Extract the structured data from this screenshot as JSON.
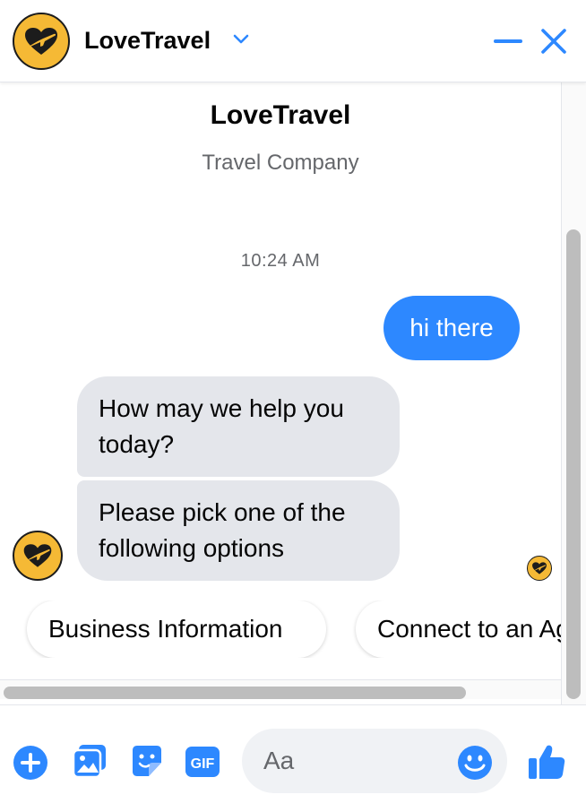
{
  "header": {
    "title": "LoveTravel",
    "avatar_icon": "heart-plane-logo-icon",
    "chevron_icon": "chevron-down-icon",
    "minimize_icon": "minimize-icon",
    "close_icon": "close-icon"
  },
  "profile": {
    "name": "LoveTravel",
    "subtitle": "Travel Company"
  },
  "conversation": {
    "timestamp": "10:24 AM",
    "messages": [
      {
        "from": "user",
        "text": "hi there"
      },
      {
        "from": "page",
        "text": "How may we help you today?"
      },
      {
        "from": "page",
        "text": "Please pick one of the following options"
      }
    ],
    "quick_replies": [
      "Business Information",
      "Connect to an Agent"
    ]
  },
  "composer": {
    "placeholder": "Aa",
    "value": "",
    "icons": [
      "add-icon",
      "photo-icon",
      "sticker-icon",
      "gif-icon",
      "emoji-icon",
      "thumbs-up-icon"
    ],
    "gif_label": "GIF"
  },
  "colors": {
    "accent": "#2d88ff",
    "brand_yellow": "#f5b935",
    "bubble_gray": "#e4e6eb",
    "text_secondary": "#65676b"
  }
}
